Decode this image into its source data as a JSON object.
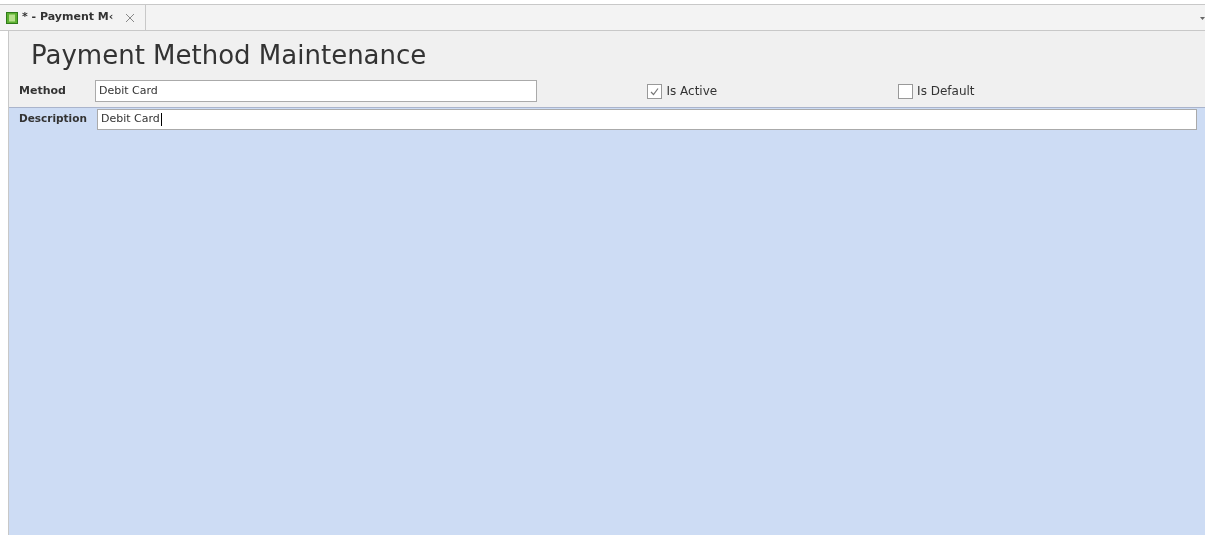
{
  "tabs": [
    {
      "label": "* - Payment M‹",
      "selected": true,
      "closable": true
    }
  ],
  "title": "Payment Method Maintenance",
  "method": {
    "label": "Method",
    "value": "Debit Card"
  },
  "checkboxes": [
    {
      "label": "Is Active",
      "checked": true
    },
    {
      "label": "Is Default",
      "checked": false
    }
  ],
  "description": {
    "label": "Description",
    "value": "Debit Card",
    "focused": true
  }
}
